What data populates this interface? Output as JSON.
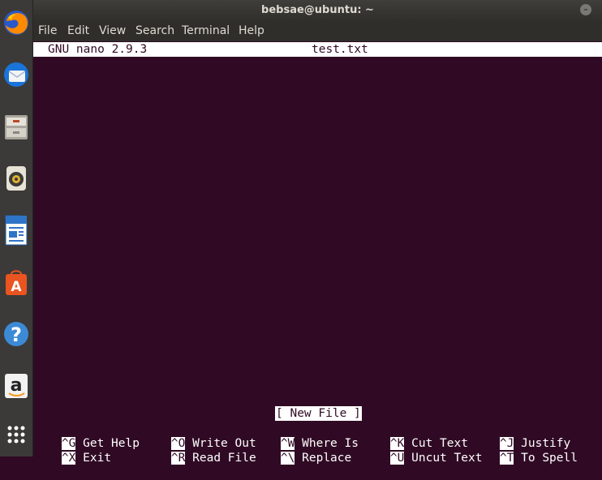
{
  "window": {
    "title": "bebsae@ubuntu: ~",
    "close_glyph": "–"
  },
  "menu": {
    "items": [
      "File",
      "Edit",
      "View",
      "Search",
      "Terminal",
      "Help"
    ]
  },
  "nano": {
    "version": "GNU nano 2.9.3",
    "filename": "test.txt",
    "status": "[ New File ]",
    "shortcuts": [
      {
        "key": "^G",
        "label": "Get Help"
      },
      {
        "key": "^O",
        "label": "Write Out"
      },
      {
        "key": "^W",
        "label": "Where Is"
      },
      {
        "key": "^K",
        "label": "Cut Text"
      },
      {
        "key": "^J",
        "label": "Justify"
      },
      {
        "key": "^X",
        "label": "Exit"
      },
      {
        "key": "^R",
        "label": "Read File"
      },
      {
        "key": "^\\",
        "label": "Replace"
      },
      {
        "key": "^U",
        "label": "Uncut Text"
      },
      {
        "key": "^T",
        "label": "To Spell"
      }
    ]
  },
  "dock": {
    "icons": [
      "firefox-icon",
      "thunderbird-icon",
      "files-icon",
      "rhythmbox-icon",
      "libreoffice-writer-icon",
      "software-center-icon",
      "help-icon",
      "amazon-icon",
      "app-grid-icon"
    ],
    "help_glyph": "?",
    "amazon_glyph": "a",
    "software_glyph": "A",
    "colors": {
      "firefox": "#e66000",
      "thunderbird": "#0a84ff",
      "help": "#3c8ad6",
      "software": "#e95420"
    }
  }
}
